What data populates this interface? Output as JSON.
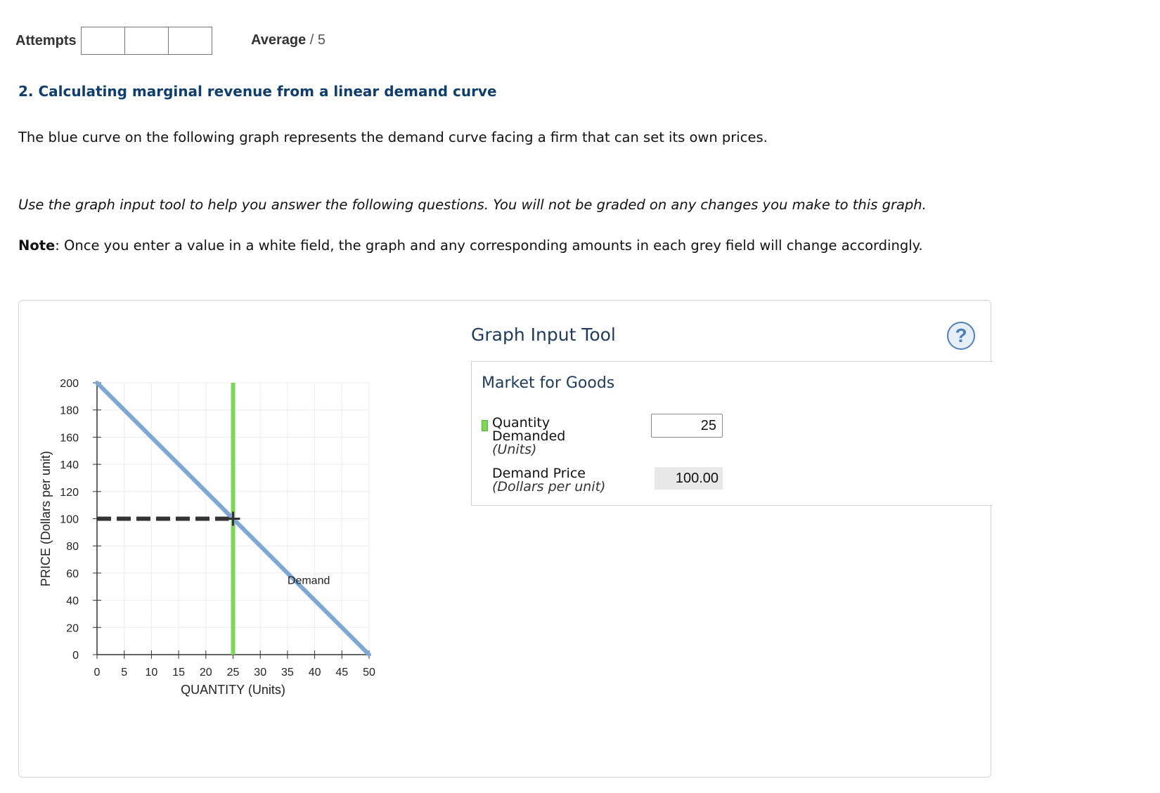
{
  "header": {
    "attempts_label": "Attempts",
    "average_label": "Average",
    "average_max": "/ 5"
  },
  "question": {
    "title": "2. Calculating marginal revenue from a linear demand curve",
    "intro": "The blue curve on the following graph represents the demand curve facing a firm that can set its own prices.",
    "instruction": "Use the graph input tool to help you answer the following questions. You will not be graded on any changes you make to this graph.",
    "note_label": "Note",
    "note_text": ": Once you enter a value in a white field, the graph and any corresponding amounts in each grey field will change accordingly."
  },
  "tool": {
    "title": "Graph Input Tool",
    "help_symbol": "?",
    "market_title": "Market for Goods",
    "quantity_label_1": "Quantity",
    "quantity_label_2": "Demanded",
    "quantity_unit": "(Units)",
    "quantity_value": "25",
    "price_label": "Demand Price",
    "price_unit": "(Dollars per unit)",
    "price_value": "100.00",
    "quantity_swatch_color": "#7bd65a"
  },
  "chart_data": {
    "type": "line",
    "xlabel": "QUANTITY (Units)",
    "ylabel": "PRICE (Dollars per unit)",
    "xlim": [
      0,
      50
    ],
    "ylim": [
      0,
      200
    ],
    "x_ticks": [
      "0",
      "5",
      "10",
      "15",
      "20",
      "25",
      "30",
      "35",
      "40",
      "45",
      "50"
    ],
    "y_ticks": [
      "0",
      "20",
      "40",
      "60",
      "80",
      "100",
      "120",
      "140",
      "160",
      "180",
      "200"
    ],
    "grid": true,
    "series": [
      {
        "name": "Demand",
        "color": "#7fa7d3",
        "x": [
          0,
          50
        ],
        "y": [
          200,
          0
        ]
      }
    ],
    "selected_quantity": 25,
    "selected_price": 100,
    "quantity_line_color": "#7bd65a",
    "guide_line_color": "#333333"
  }
}
